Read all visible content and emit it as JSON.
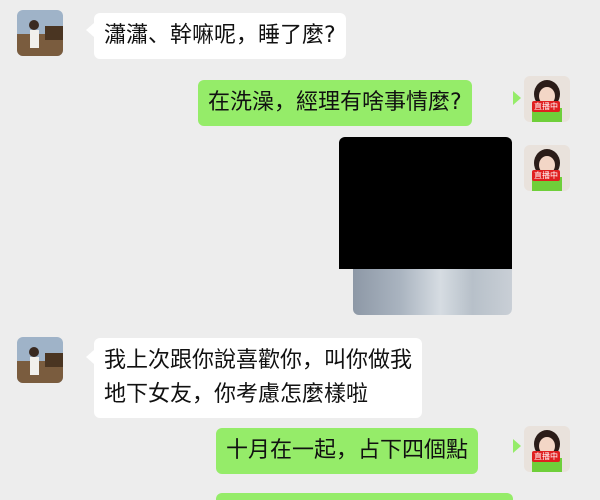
{
  "messages": [
    {
      "side": "in",
      "text": "瀟瀟、幹嘛呢，睡了麼?"
    },
    {
      "side": "out",
      "text": "在洗澡，經理有啥事情麼?"
    },
    {
      "side": "in",
      "line1": "我上次跟你說喜歡你，叫你做我",
      "line2": "地下女友，你考慮怎麼樣啦"
    },
    {
      "side": "out",
      "text": "十月在一起，占下四個點"
    }
  ],
  "avatar_badge": "直播中",
  "colors": {
    "background": "#ededed",
    "incoming": "#ffffff",
    "outgoing": "#95ec69",
    "badge": "#e02020"
  },
  "media_message": {
    "type": "image",
    "content": "redacted photo"
  }
}
